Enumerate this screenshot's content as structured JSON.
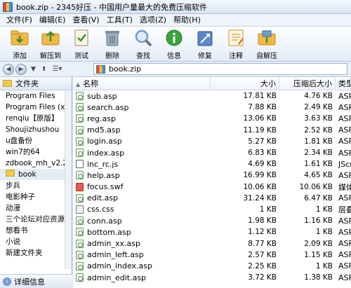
{
  "window": {
    "title": "book.zip - 2345好压 - 中国用户量最大的免费压缩软件"
  },
  "menu": [
    "文件(F)",
    "编辑(E)",
    "查看(V)",
    "工具(T)",
    "选项(Z)",
    "帮助(H)"
  ],
  "toolbar": [
    {
      "label": "添加",
      "icon": "add-icon",
      "color": "#f0a830"
    },
    {
      "label": "解压到",
      "icon": "extract-icon",
      "color": "#f0a830"
    },
    {
      "label": "测试",
      "icon": "test-icon",
      "color": "#7aa04a"
    },
    {
      "label": "删除",
      "icon": "delete-icon",
      "color": "#5c6f86"
    },
    {
      "label": "查找",
      "icon": "find-icon",
      "color": "#6e9bd1"
    },
    {
      "label": "信息",
      "icon": "info-icon",
      "color": "#3aa53a"
    },
    {
      "label": "修复",
      "icon": "repair-icon",
      "color": "#4a74b8"
    },
    {
      "label": "注释",
      "icon": "comment-icon",
      "color": "#e6a13a"
    },
    {
      "label": "自解压",
      "icon": "sfx-icon",
      "color": "#f0a830"
    }
  ],
  "address": {
    "path": "book.zip"
  },
  "left_pane": {
    "header": "文件夹",
    "items": [
      "Program Files",
      "Program Files (x8",
      "renqiu【原版】",
      "Shoujizhushou",
      "u盘备份",
      "win7的64",
      "zdbook_mh_v2.2",
      "book",
      "步兵",
      "电影种子",
      "动漫",
      "三个论坛对应资源",
      "想看书",
      "小说",
      "新建文件夹"
    ],
    "selected_index": 7,
    "detail": "详细信息"
  },
  "columns": {
    "name": "名称",
    "size": "大小",
    "packed": "压缩后大小",
    "type": "类型"
  },
  "files": [
    {
      "name": "sub.asp",
      "size": "17.81 KB",
      "packed": "4.76 KB",
      "type": "ASP",
      "icon": "asp"
    },
    {
      "name": "search.asp",
      "size": "7.88 KB",
      "packed": "2.49 KB",
      "type": "ASP",
      "icon": "asp"
    },
    {
      "name": "reg.asp",
      "size": "13.06 KB",
      "packed": "3.63 KB",
      "type": "ASP",
      "icon": "asp"
    },
    {
      "name": "md5.asp",
      "size": "11.19 KB",
      "packed": "2.52 KB",
      "type": "ASP",
      "icon": "asp"
    },
    {
      "name": "login.asp",
      "size": "5.27 KB",
      "packed": "1.81 KB",
      "type": "ASP",
      "icon": "asp"
    },
    {
      "name": "index.asp",
      "size": "6.83 KB",
      "packed": "2.34 KB",
      "type": "ASP",
      "icon": "asp"
    },
    {
      "name": "inc_rc.js",
      "size": "4.69 KB",
      "packed": "1.61 KB",
      "type": "JScr",
      "icon": "js"
    },
    {
      "name": "help.asp",
      "size": "16.99 KB",
      "packed": "4.65 KB",
      "type": "ASP",
      "icon": "asp"
    },
    {
      "name": "focus.swf",
      "size": "10.06 KB",
      "packed": "10.06 KB",
      "type": "媒体",
      "icon": "swf"
    },
    {
      "name": "edit.asp",
      "size": "31.24 KB",
      "packed": "6.47 KB",
      "type": "ASP",
      "icon": "asp"
    },
    {
      "name": "css.css",
      "size": "1 KB",
      "packed": "1 KB",
      "type": "层叠",
      "icon": "css"
    },
    {
      "name": "conn.asp",
      "size": "1.98 KB",
      "packed": "1.16 KB",
      "type": "ASP",
      "icon": "asp"
    },
    {
      "name": "bottom.asp",
      "size": "1.12 KB",
      "packed": "1 KB",
      "type": "ASP",
      "icon": "asp"
    },
    {
      "name": "admin_xx.asp",
      "size": "8.77 KB",
      "packed": "2.09 KB",
      "type": "ASP",
      "icon": "asp"
    },
    {
      "name": "admin_left.asp",
      "size": "2.57 KB",
      "packed": "1.15 KB",
      "type": "ASP",
      "icon": "asp"
    },
    {
      "name": "admin_index.asp",
      "size": "2.25 KB",
      "packed": "1 KB",
      "type": "ASP",
      "icon": "asp"
    },
    {
      "name": "admin_edit.asp",
      "size": "3.72 KB",
      "packed": "1.38 KB",
      "type": "ASP",
      "icon": "asp"
    }
  ]
}
